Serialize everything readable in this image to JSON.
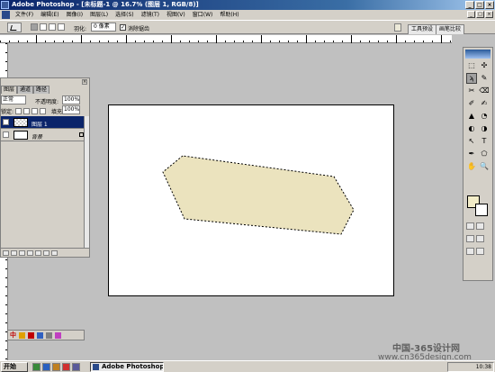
{
  "window": {
    "title": "Adobe Photoshop - [未标题-1 @ 16.7% (图层 1, RGB/8)]",
    "controls": [
      "_",
      "□",
      "×"
    ]
  },
  "menubar": {
    "items": [
      "文件(F)",
      "编辑(E)",
      "图像(I)",
      "图层(L)",
      "选择(S)",
      "滤镜(T)",
      "视图(V)",
      "窗口(W)",
      "帮助(H)"
    ],
    "doc_controls": [
      "_",
      "□",
      "×"
    ]
  },
  "options": {
    "feather_label": "羽化:",
    "feather_value": "0 像素",
    "antialias_label": "消除锯齿",
    "antialias_checked": "✓",
    "tab_tool_presets": "工具预设",
    "tab_brushes": "画笔比较"
  },
  "layers_panel": {
    "tabs": [
      "图层",
      "通道",
      "路径"
    ],
    "blend_mode": "正常",
    "opacity_label": "不透明度:",
    "opacity_value": "100%",
    "lock_label": "锁定:",
    "fill_label": "填充:",
    "fill_value": "100%",
    "layers": [
      {
        "name": "图层 1"
      },
      {
        "name": "背景"
      }
    ]
  },
  "toolbox": {
    "tools": [
      "⬚",
      "✣",
      "ϡ",
      "✎",
      "✂",
      "⌫",
      "✐",
      "✍",
      "▲",
      "◔",
      "◐",
      "◑",
      "↖",
      "T",
      "✒",
      "⬠",
      "✋",
      "🔍"
    ],
    "foreground_color": "#f3edc8",
    "background_color": "#ffffff"
  },
  "shape": {
    "fill": "#ebe3be",
    "description_none": ""
  },
  "ime": {
    "label": "中"
  },
  "watermark": {
    "title": "中国-365设计网",
    "url": "www.cn365design.com"
  },
  "taskbar": {
    "start_label": "开始",
    "task_label": "Adobe Photoshop - [...",
    "clock": "10:38"
  }
}
